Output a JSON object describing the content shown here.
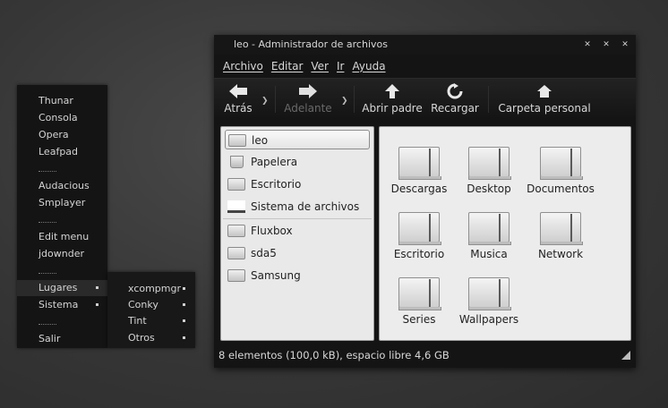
{
  "root_menu": {
    "items": [
      "Thunar",
      "Consola",
      "Opera",
      "Leafpad",
      "Audacious",
      "Smplayer",
      "Edit menu",
      "jdownder",
      "Lugares",
      "Sistema",
      "Salir"
    ]
  },
  "submenu": {
    "items": [
      "xcompmgr",
      "Conky",
      "Tint",
      "Otros"
    ]
  },
  "window": {
    "title": "leo - Administrador de archivos",
    "menubar": [
      "Archivo",
      "Editar",
      "Ver",
      "Ir",
      "Ayuda"
    ],
    "toolbar": {
      "back": "Atrás",
      "forward": "Adelante",
      "open_parent": "Abrir padre",
      "reload": "Recargar",
      "home": "Carpeta personal"
    },
    "places": [
      "leo",
      "Papelera",
      "Escritorio",
      "Sistema de archivos",
      "Fluxbox",
      "sda5",
      "Samsung"
    ],
    "files": [
      "Descargas",
      "Desktop",
      "Documentos",
      "Escritorio",
      "Musica",
      "Network",
      "Series",
      "Wallpapers"
    ],
    "status": "8 elementos (100,0 kB), espacio libre 4,6 GB"
  },
  "colors": {
    "window_bg": "#141414",
    "pane_bg": "#ececec",
    "menu_bg": "#141414"
  }
}
